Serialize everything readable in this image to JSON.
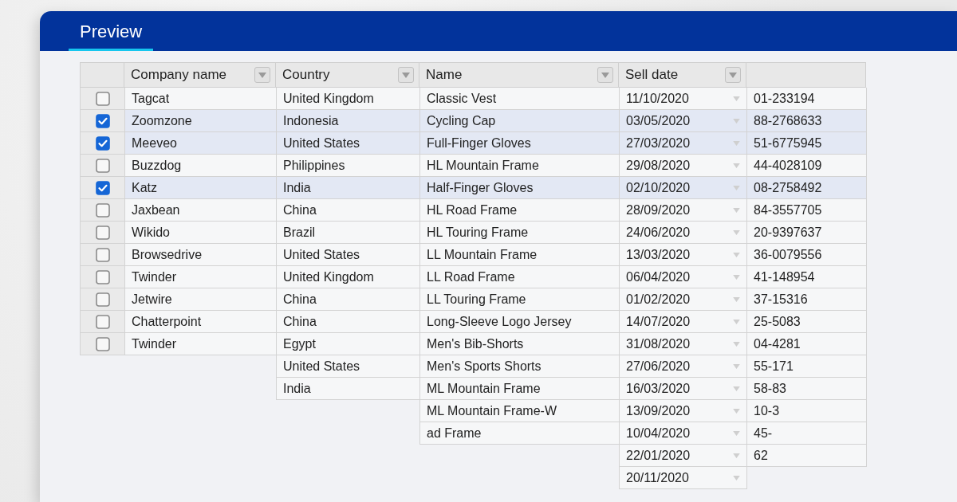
{
  "header": {
    "tabs": [
      {
        "label": "Preview",
        "selected": true
      }
    ]
  },
  "table": {
    "columns": [
      {
        "label": "Company name",
        "filter": true,
        "kind": "text"
      },
      {
        "label": "Country",
        "filter": true,
        "kind": "text"
      },
      {
        "label": "Name",
        "filter": true,
        "kind": "text"
      },
      {
        "label": "Sell date",
        "filter": true,
        "kind": "date"
      },
      {
        "kind": "text"
      }
    ],
    "rows": [
      {
        "selected": false,
        "checkbox": {
          "checked": false
        },
        "company_name": "Tagcat",
        "country": "United Kingdom",
        "name": "Classic Vest",
        "sell_date": "11/10/2020",
        "column_6": "01-233194"
      },
      {
        "selected": true,
        "checkbox": {
          "checked": true
        },
        "company_name": "Zoomzone",
        "country": "Indonesia",
        "name": "Cycling Cap",
        "sell_date": "03/05/2020",
        "column_6": "88-2768633"
      },
      {
        "selected": true,
        "checkbox": {
          "checked": true
        },
        "company_name": "Meeveo",
        "country": "United States",
        "name": "Full-Finger Gloves",
        "sell_date": "27/03/2020",
        "column_6": "51-6775945"
      },
      {
        "selected": false,
        "checkbox": {
          "checked": false
        },
        "company_name": "Buzzdog",
        "country": "Philippines",
        "name": "HL Mountain Frame",
        "sell_date": "29/08/2020",
        "column_6": "44-4028109"
      },
      {
        "selected": true,
        "checkbox": {
          "checked": true
        },
        "company_name": "Katz",
        "country": "India",
        "name": "Half-Finger Gloves",
        "sell_date": "02/10/2020",
        "column_6": "08-2758492"
      },
      {
        "selected": false,
        "checkbox": {
          "checked": false
        },
        "company_name": "Jaxbean",
        "country": "China",
        "name": "HL Road Frame",
        "sell_date": "28/09/2020",
        "column_6": "84-3557705"
      },
      {
        "selected": false,
        "checkbox": {
          "checked": false
        },
        "company_name": "Wikido",
        "country": "Brazil",
        "name": "HL Touring Frame",
        "sell_date": "24/06/2020",
        "column_6": "20-9397637"
      },
      {
        "selected": false,
        "checkbox": {
          "checked": false
        },
        "company_name": "Browsedrive",
        "country": "United States",
        "name": "LL Mountain Frame",
        "sell_date": "13/03/2020",
        "column_6": "36-0079556"
      },
      {
        "selected": false,
        "checkbox": {
          "checked": false
        },
        "company_name": "Twinder",
        "country": "United Kingdom",
        "name": "LL Road Frame",
        "sell_date": "06/04/2020",
        "column_6": "41-148954"
      },
      {
        "selected": false,
        "checkbox": {
          "checked": false
        },
        "company_name": "Jetwire",
        "country": "China",
        "name": "LL Touring Frame",
        "sell_date": "01/02/2020",
        "column_6": "37-15316"
      },
      {
        "selected": false,
        "checkbox": {
          "checked": false
        },
        "company_name": "Chatterpoint",
        "country": "China",
        "name": "Long-Sleeve Logo Jersey",
        "sell_date": "14/07/2020",
        "column_6": "25-5083"
      },
      {
        "selected": false,
        "checkbox": {
          "checked": false
        },
        "company_name": "Twinder",
        "country": "Egypt",
        "name": "Men's Bib-Shorts",
        "sell_date": "31/08/2020",
        "column_6": "04-4281"
      },
      {
        "selected": false,
        "country": "United States",
        "name": "Men's Sports Shorts",
        "sell_date": "27/06/2020",
        "column_6": "55-171"
      },
      {
        "selected": false,
        "country": "India",
        "name": "ML Mountain Frame",
        "sell_date": "16/03/2020",
        "column_6": "58-83"
      },
      {
        "selected": false,
        "name": "ML Mountain Frame-W",
        "sell_date": "13/09/2020",
        "column_6": "10-3"
      },
      {
        "selected": false,
        "name": "ad Frame",
        "sell_date": "10/04/2020",
        "column_6": "45-"
      },
      {
        "selected": false,
        "sell_date": "22/01/2020",
        "column_6": "62"
      },
      {
        "selected": false,
        "sell_date": "20/11/2020"
      }
    ]
  }
}
